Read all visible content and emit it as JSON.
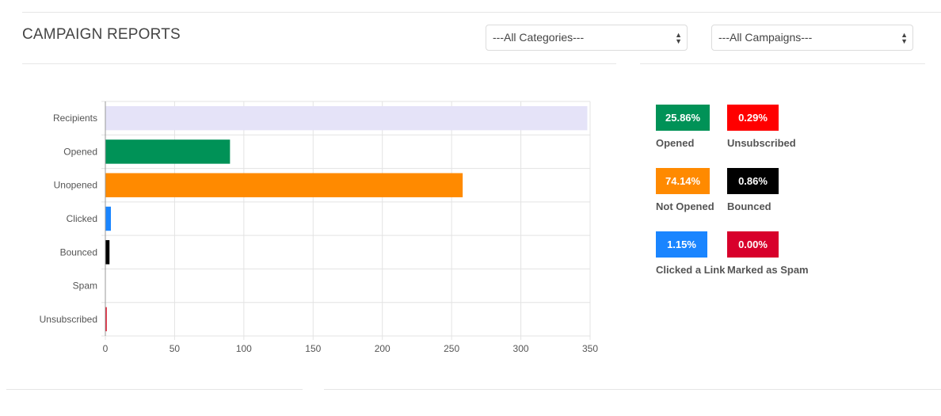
{
  "header": {
    "title": "CAMPAIGN REPORTS",
    "category_select": {
      "value": "---All Categories---"
    },
    "campaign_select": {
      "value": "---All Campaigns---"
    }
  },
  "chart_data": {
    "type": "bar",
    "orientation": "horizontal",
    "categories": [
      "Recipients",
      "Opened",
      "Unopened",
      "Clicked",
      "Bounced",
      "Spam",
      "Unsubscribed"
    ],
    "values": [
      348,
      90,
      258,
      4,
      3,
      0,
      1
    ],
    "colors": [
      "#e5e3f8",
      "#009257",
      "#ff8a00",
      "#1a85ff",
      "#000000",
      "#cccccc",
      "#e0001b"
    ],
    "xlim": [
      0,
      350
    ],
    "xticks": [
      0,
      50,
      100,
      150,
      200,
      250,
      300,
      350
    ],
    "grid": true,
    "title": "",
    "xlabel": "",
    "ylabel": ""
  },
  "stats": [
    {
      "value": "25.86%",
      "label": "Opened",
      "color": "#009257"
    },
    {
      "value": "0.29%",
      "label": "Unsubscribed",
      "color": "#ff0000"
    },
    {
      "value": "74.14%",
      "label": "Not Opened",
      "color": "#ff8a00"
    },
    {
      "value": "0.86%",
      "label": "Bounced",
      "color": "#000000"
    },
    {
      "value": "1.15%",
      "label": "Clicked a Link",
      "color": "#1a85ff"
    },
    {
      "value": "0.00%",
      "label": "Marked as Spam",
      "color": "#d8002b"
    }
  ]
}
